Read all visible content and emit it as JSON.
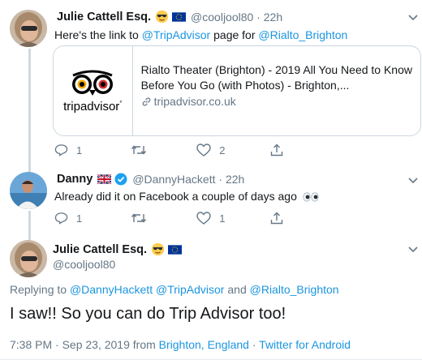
{
  "tweets": [
    {
      "name": "Julie Cattell Esq.",
      "handle": "@cooljool80",
      "time": "22h",
      "text_prefix": "Here's the link to ",
      "mention1": "@TripAdvisor",
      "text_mid": " page for ",
      "mention2": "@Rialto_Brighton",
      "card": {
        "logo_trip": "trip",
        "logo_advisor": "advisor",
        "title_line1": "Rialto Theater (Brighton) - 2019 All You Need to Know",
        "title_line2": "Before You Go (with Photos) - Brighton,...",
        "domain": "tripadvisor.co.uk"
      },
      "actions": {
        "replies": "1",
        "retweets": "",
        "likes": "2"
      }
    },
    {
      "name": "Danny",
      "handle": "@DannyHackett",
      "time": "22h",
      "text": "Already did it on Facebook a couple of days ago",
      "actions": {
        "replies": "1",
        "retweets": "",
        "likes": "1"
      }
    }
  ],
  "main_tweet": {
    "name": "Julie Cattell Esq.",
    "handle": "@cooljool80",
    "replying_prefix": "Replying to ",
    "replying_mention1": "@DannyHackett",
    "replying_mention2": "@TripAdvisor",
    "replying_and": " and ",
    "replying_mention3": "@Rialto_Brighton",
    "text": "I saw!! So you can do Trip Advisor too!",
    "timestamp": "7:38 PM · Sep 23, 2019 from ",
    "location": "Brighton, England",
    "meta_sep": " · ",
    "client": "Twitter for Android"
  },
  "icons": [
    "reply-icon",
    "retweet-icon",
    "like-icon",
    "share-icon",
    "chevron-down-icon",
    "link-icon",
    "verified-icon",
    "sunglasses-emoji-icon",
    "eu-flag-icon",
    "uk-flag-icon",
    "eyes-emoji-icon"
  ],
  "colors": {
    "link": "#1b95e0",
    "secondary": "#657786",
    "border": "#ccd6dd",
    "verified": "#1da1f2"
  }
}
